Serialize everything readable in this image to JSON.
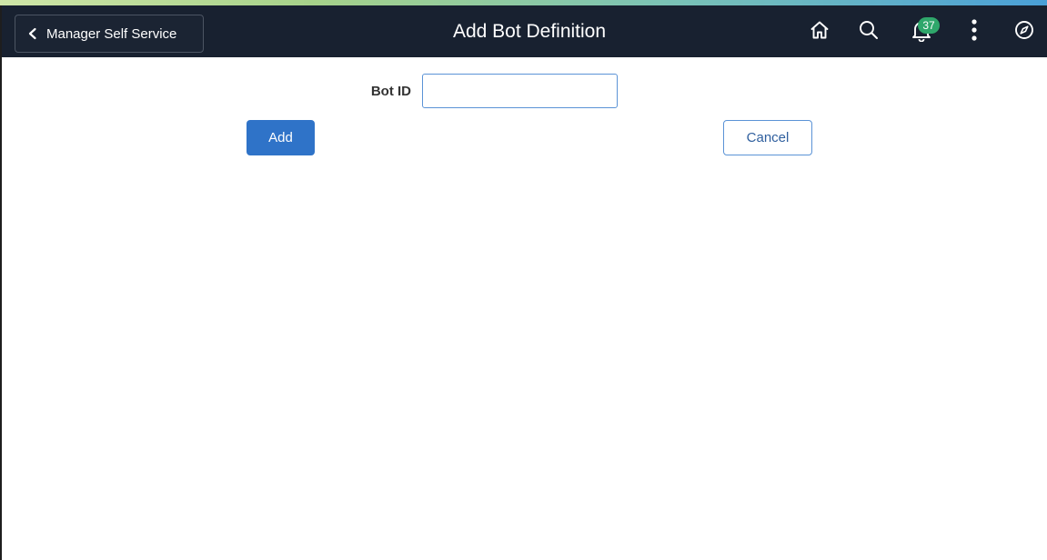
{
  "header": {
    "back_label": "Manager Self Service",
    "title": "Add Bot Definition",
    "notification_count": "37",
    "icons": [
      "chevron-left-icon",
      "home-icon",
      "search-icon",
      "bell-icon",
      "more-vertical-icon",
      "compass-icon"
    ]
  },
  "form": {
    "bot_id_label": "Bot ID",
    "bot_id_value": "",
    "add_label": "Add",
    "cancel_label": "Cancel"
  },
  "colors": {
    "header_bg": "#182130",
    "primary": "#2f73c8",
    "badge": "#2fa76b"
  }
}
